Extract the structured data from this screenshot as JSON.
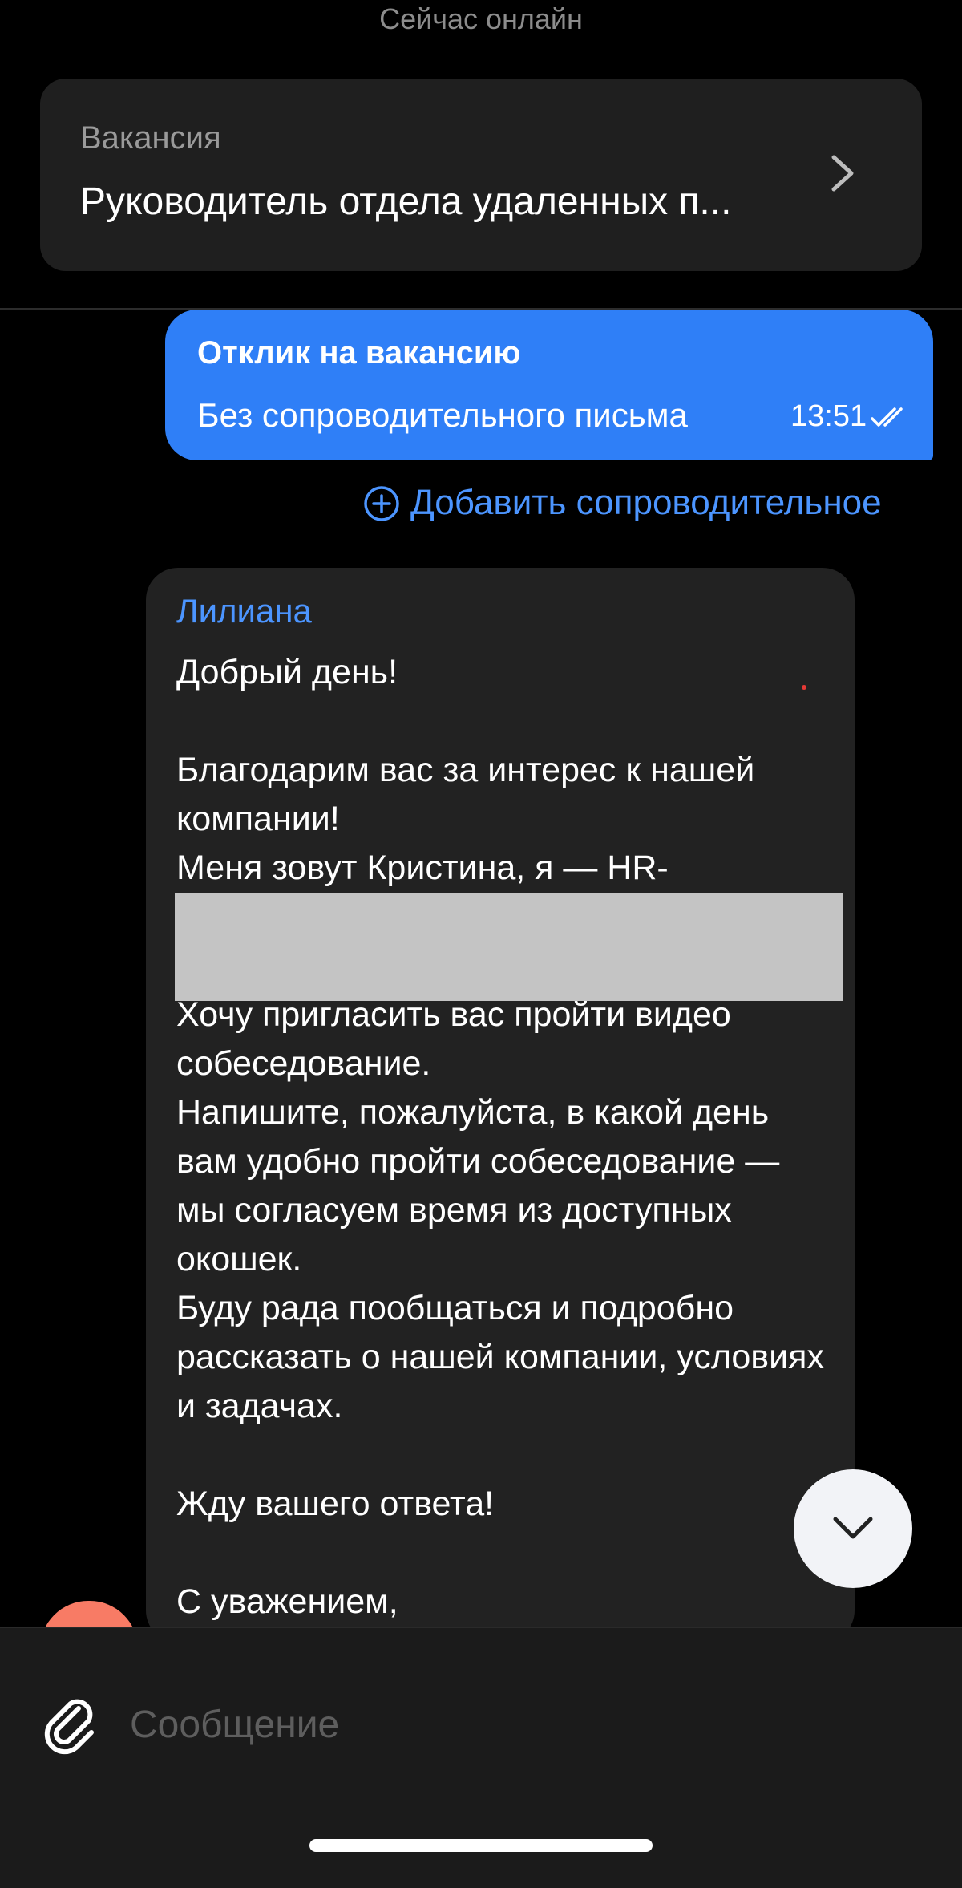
{
  "header": {
    "status": "Сейчас онлайн"
  },
  "vacancy": {
    "label": "Вакансия",
    "title": "Руководитель отдела удаленных п..."
  },
  "sent_message": {
    "title": "Отклик на вакансию",
    "body": "Без сопроводительного письма",
    "time": "13:51"
  },
  "add_cover_letter": {
    "label": "Добавить сопроводительное"
  },
  "received_message": {
    "sender": "Лилиана",
    "paragraphs": [
      "Добрый день!",
      "",
      "Благодарим вас за интерес к нашей компании!",
      "Меня зовут Кристина, я — HR-",
      "",
      "",
      "Хочу пригласить вас пройти видео собеседование.",
      "Напишите, пожалуйста, в какой день вам удобно пройти собеседование — мы согласуем время из доступных окошек.",
      "Буду рада пообщаться и подробно рассказать о нашей компании, условиях и задачах.",
      "",
      "Жду вашего ответа!",
      "",
      "С уважением,"
    ]
  },
  "composer": {
    "placeholder": "Сообщение"
  },
  "colors": {
    "accent": "#2f7ff7",
    "link": "#4c95ff",
    "bubble_received": "#222222",
    "redaction": "#c4c4c4"
  }
}
